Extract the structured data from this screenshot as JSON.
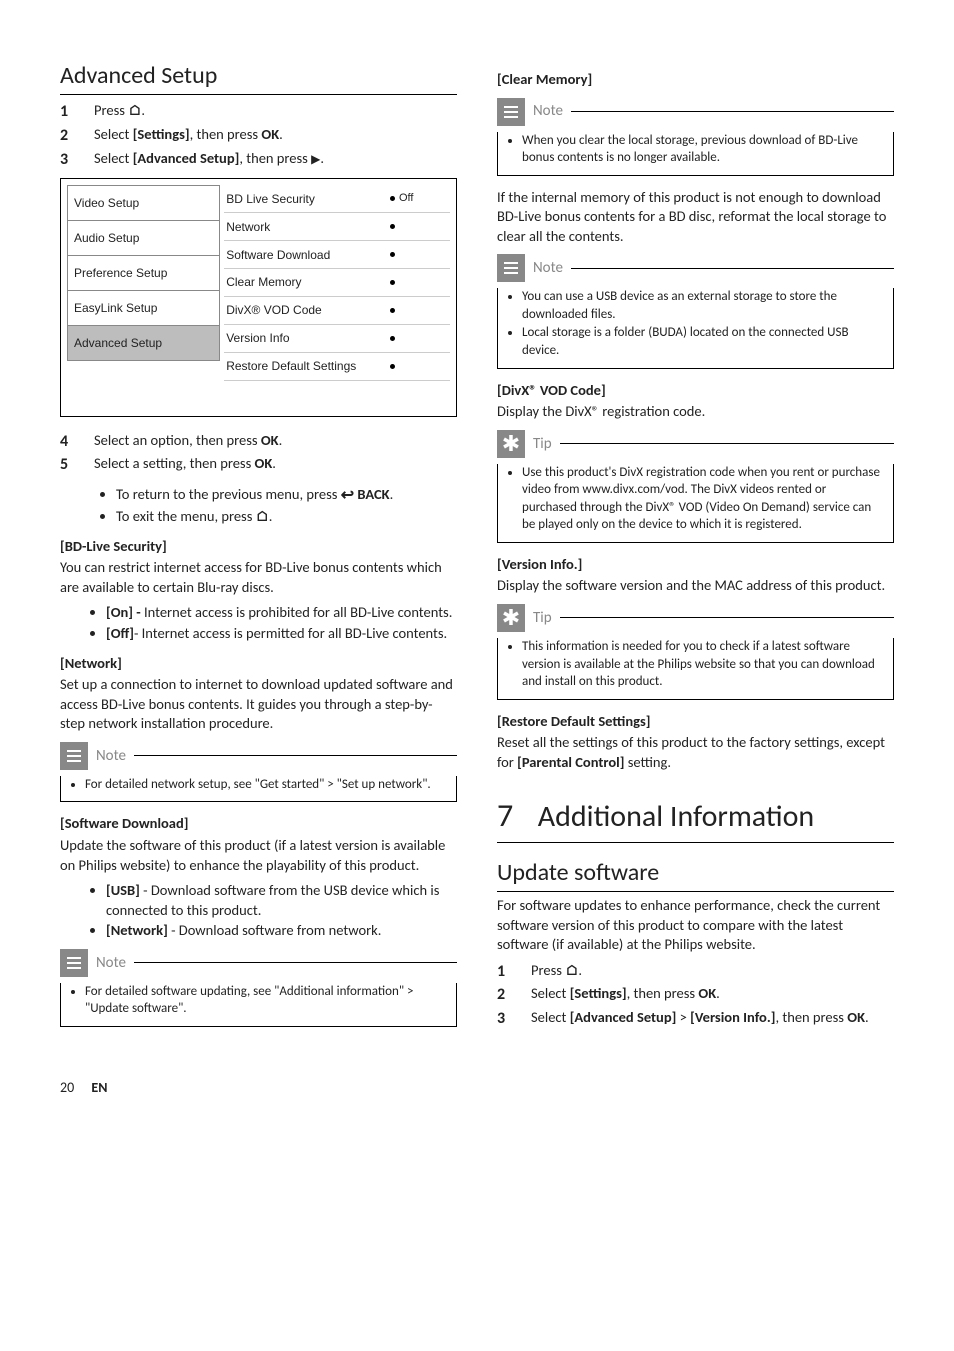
{
  "left": {
    "title": "Advanced Setup",
    "steps_a": [
      {
        "n": "1",
        "pre": "Press ",
        "icon": "home",
        "post": "."
      },
      {
        "n": "2",
        "t": [
          "Select ",
          [
            "b",
            "[Settings]"
          ],
          ", then press ",
          [
            "b",
            "OK"
          ],
          "."
        ]
      },
      {
        "n": "3",
        "t": [
          "Select ",
          [
            "b",
            "[Advanced Setup]"
          ],
          ", then press ",
          [
            "icon",
            "play"
          ],
          "."
        ]
      }
    ],
    "ui": {
      "left_items": [
        "Video Setup",
        "Audio Setup",
        "Preference Setup",
        "EasyLink Setup",
        "Advanced Setup"
      ],
      "selected_index": 4,
      "right_rows": [
        {
          "label": "BD Live Security",
          "val": "Off",
          "filled": true
        },
        {
          "label": "Network",
          "filled": true
        },
        {
          "label": "Software Download",
          "filled": true
        },
        {
          "label": "Clear Memory",
          "filled": true
        },
        {
          "label": "DivX® VOD Code",
          "filled": true
        },
        {
          "label": "Version Info",
          "filled": true
        },
        {
          "label": "Restore Default Settings",
          "filled": true
        },
        {
          "label": ""
        }
      ]
    },
    "steps_b": [
      {
        "n": "4",
        "t": [
          "Select an option, then press ",
          [
            "b",
            "OK"
          ],
          "."
        ]
      },
      {
        "n": "5",
        "t": [
          "Select a setting, then press ",
          [
            "b",
            "OK"
          ],
          "."
        ]
      }
    ],
    "sub_b": [
      [
        "To return to the previous menu, press ",
        [
          "icon",
          "back"
        ],
        " ",
        [
          "b",
          "BACK"
        ],
        "."
      ],
      [
        "To exit the menu, press ",
        [
          "icon",
          "home"
        ],
        "."
      ]
    ],
    "bdlive": {
      "head": "[BD-Live Security]",
      "intro": "You can restrict internet access for BD-Live bonus contents which are available to certain Blu-ray discs.",
      "opts": [
        [
          [
            "b",
            "[On] - "
          ],
          "Internet access is prohibited for all BD-Live contents."
        ],
        [
          [
            "b",
            "[Off]"
          ],
          "- Internet access is permitted for all BD-Live contents."
        ]
      ]
    },
    "network": {
      "head": "[Network]",
      "body": "Set up a connection to internet to download updated software and access BD-Live bonus contents. It guides you through a step-by-step network installation procedure."
    },
    "note1": {
      "label": "Note",
      "items": [
        "For detailed network setup, see \"Get started\" > \"Set up network\"."
      ]
    },
    "swdl": {
      "head": "[Software Download]",
      "intro": "Update the software of this product (if a latest version is available on Philips website) to enhance the playability of this product.",
      "opts": [
        [
          [
            "b",
            "[USB]"
          ],
          " - Download software from the USB device which is connected to this product."
        ],
        [
          [
            "b",
            "[Network]"
          ],
          " - Download software from network."
        ]
      ]
    },
    "note2": {
      "label": "Note",
      "items": [
        "For detailed software updating, see \"Additional information\" > \"Update software\"."
      ]
    }
  },
  "right": {
    "clearmem": {
      "head": "[Clear Memory]",
      "note": {
        "label": "Note",
        "items": [
          "When you clear the local storage, previous download of BD-Live bonus contents is no longer available."
        ]
      },
      "body": "If the internal memory of this product is not enough to download BD-Live bonus contents for a BD disc, reformat the local storage to clear all the contents.",
      "note2": {
        "label": "Note",
        "items": [
          "You can use a USB device as an external storage to store the downloaded files.",
          "Local storage is a folder (BUDA) located on the connected USB device."
        ]
      }
    },
    "divx": {
      "head": "[DivX® VOD Code]",
      "body": "Display the DivX® registration code.",
      "tip": {
        "label": "Tip",
        "items": [
          "Use this product's DivX registration code when you rent or purchase video from www.divx.com/vod. The DivX videos rented or purchased through the DivX® VOD (Video On Demand) service can be played only on the device to which it is registered."
        ]
      }
    },
    "version": {
      "head": "[Version Info.]",
      "body": "Display the software version and the MAC address of this product.",
      "tip": {
        "label": "Tip",
        "items": [
          "This information is needed for you to check if a latest software version is available at the Philips website so that you can download and install on this product."
        ]
      }
    },
    "restore": {
      "head": "[Restore Default Settings]",
      "body": [
        "Reset all the settings of this product to the factory settings, except for ",
        [
          "b",
          "[Parental Control]"
        ],
        " setting."
      ]
    },
    "chapter": {
      "num": "7",
      "title": "Additional Information"
    },
    "update": {
      "title": "Update software",
      "intro": "For software updates to enhance performance, check the current software version of this product to compare with the latest software (if available) at the Philips website.",
      "steps": [
        {
          "n": "1",
          "pre": "Press ",
          "icon": "home",
          "post": "."
        },
        {
          "n": "2",
          "t": [
            "Select ",
            [
              "b",
              "[Settings]"
            ],
            ", then press ",
            [
              "b",
              "OK"
            ],
            "."
          ]
        },
        {
          "n": "3",
          "t": [
            "Select ",
            [
              "b",
              "[Advanced Setup]"
            ],
            " > ",
            [
              "b",
              "[Version Info.]"
            ],
            ", then press ",
            [
              "b",
              "OK"
            ],
            "."
          ]
        }
      ]
    }
  },
  "footer": {
    "page": "20",
    "lang": "EN"
  }
}
